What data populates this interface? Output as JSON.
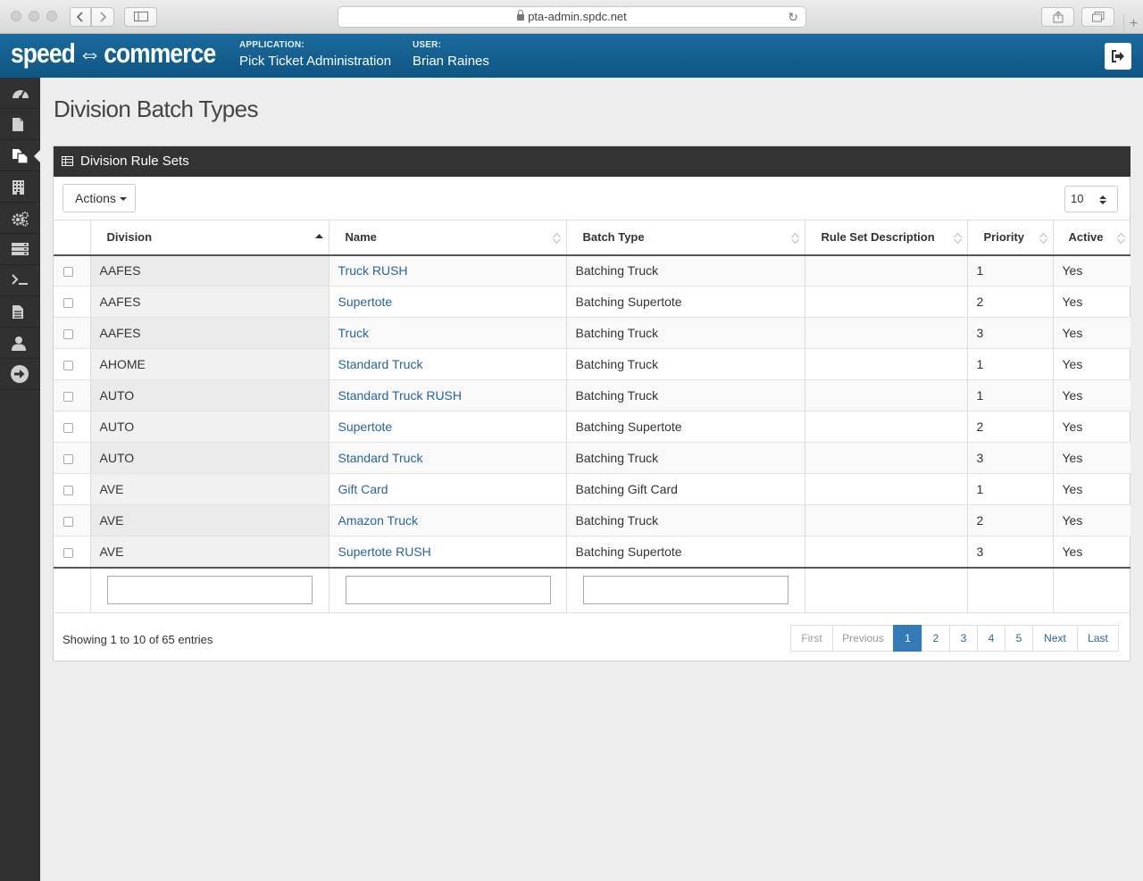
{
  "browser": {
    "url": "pta-admin.spdc.net",
    "new_tab": "+"
  },
  "header": {
    "logo_left": "speed",
    "logo_right": "commerce",
    "application_label": "APPLICATION:",
    "application_value": "Pick Ticket Administration",
    "user_label": "USER:",
    "user_value": "Brian Raines"
  },
  "sidebar": {
    "items": [
      {
        "icon": "dashboard-icon"
      },
      {
        "icon": "file-icon"
      },
      {
        "icon": "copy-icon",
        "active": true
      },
      {
        "icon": "building-icon"
      },
      {
        "icon": "cogs-icon"
      },
      {
        "icon": "server-icon"
      },
      {
        "icon": "terminal-icon"
      },
      {
        "icon": "document-icon"
      },
      {
        "icon": "user-icon"
      },
      {
        "icon": "arrow-circle-icon"
      }
    ]
  },
  "page": {
    "title": "Division Batch Types"
  },
  "panel": {
    "title": "Division Rule Sets",
    "actions_label": "Actions",
    "page_length": "10"
  },
  "table": {
    "columns": [
      "Division",
      "Name",
      "Batch Type",
      "Rule Set Description",
      "Priority",
      "Active"
    ],
    "rows": [
      {
        "division": "AAFES",
        "name": "Truck RUSH",
        "batch_type": "Batching Truck",
        "description": "",
        "priority": "1",
        "active": "Yes"
      },
      {
        "division": "AAFES",
        "name": "Supertote",
        "batch_type": "Batching Supertote",
        "description": "",
        "priority": "2",
        "active": "Yes"
      },
      {
        "division": "AAFES",
        "name": "Truck",
        "batch_type": "Batching Truck",
        "description": "",
        "priority": "3",
        "active": "Yes"
      },
      {
        "division": "AHOME",
        "name": "Standard Truck",
        "batch_type": "Batching Truck",
        "description": "",
        "priority": "1",
        "active": "Yes"
      },
      {
        "division": "AUTO",
        "name": "Standard Truck RUSH",
        "batch_type": "Batching Truck",
        "description": "",
        "priority": "1",
        "active": "Yes"
      },
      {
        "division": "AUTO",
        "name": "Supertote",
        "batch_type": "Batching Supertote",
        "description": "",
        "priority": "2",
        "active": "Yes"
      },
      {
        "division": "AUTO",
        "name": "Standard Truck",
        "batch_type": "Batching Truck",
        "description": "",
        "priority": "3",
        "active": "Yes"
      },
      {
        "division": "AVE",
        "name": "Gift Card",
        "batch_type": "Batching Gift Card",
        "description": "",
        "priority": "1",
        "active": "Yes"
      },
      {
        "division": "AVE",
        "name": "Amazon Truck",
        "batch_type": "Batching Truck",
        "description": "",
        "priority": "2",
        "active": "Yes"
      },
      {
        "division": "AVE",
        "name": "Supertote RUSH",
        "batch_type": "Batching Supertote",
        "description": "",
        "priority": "3",
        "active": "Yes"
      }
    ]
  },
  "footer": {
    "info": "Showing 1 to 10 of 65 entries",
    "pagination": {
      "first": "First",
      "previous": "Previous",
      "pages": [
        "1",
        "2",
        "3",
        "4",
        "5"
      ],
      "current": "1",
      "next": "Next",
      "last": "Last"
    }
  }
}
